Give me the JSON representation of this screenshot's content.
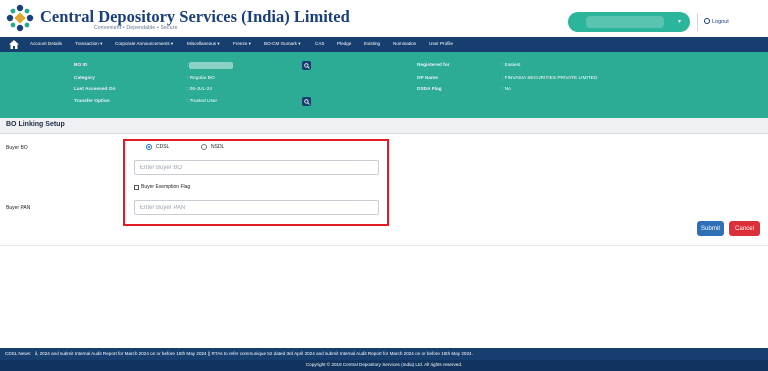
{
  "brand": {
    "title": "Central Depository Services (India) Limited",
    "tagline": "Convenient  •  Dependable  •  Secure",
    "logo_icon": "cdsl-logo-icon"
  },
  "header": {
    "logout_label": "Logout",
    "user_select_color": "#2bb59a"
  },
  "nav": {
    "items": [
      "Account Details",
      "Transaction ▾",
      "Corporate Announcements ▾",
      "Miscellaneous ▾",
      "Freeze ▾",
      "BO-CM Gumark ▾",
      "CAS",
      "Pledge",
      "Existing",
      "Nomination",
      "User Profile"
    ]
  },
  "info": {
    "bo_id_label": "BO ID",
    "bo_id_value": ":",
    "category_label": "Category",
    "category_value": ": Regular BO",
    "last_accessed_label": "Last Accessed On",
    "last_accessed_value": ": 06-JUL-24",
    "transfer_label": "Transfer Option",
    "transfer_value": ": Trusted User",
    "registered_label": "Registered for",
    "registered_value": ": Easiest",
    "dp_name_label": "DP Name",
    "dp_name_value": ": FINVASIA SECURITIES PRIVATE LIMITED",
    "ddsa_label": "DSDA Flag",
    "ddsa_value": ": No"
  },
  "form": {
    "section_title": "BO Linking Setup",
    "buyer_bo_label": "Buyer BO",
    "radio_cdsl": "CDSL",
    "radio_nsdl": "NSDL",
    "selected_depository": "CDSL",
    "buyer_bo_placeholder": "Enter Buyer BO",
    "exemption_label": "Buyer Exemption Flag",
    "buyer_pan_label": "Buyer PAN",
    "buyer_pan_placeholder": "Enter Buyer PAN",
    "submit_label": "Submit",
    "cancel_label": "Cancel"
  },
  "footer": {
    "news_label": "CDSL News:",
    "news_text": "il, 2024 and submit Internal Audit Report for March 2024 on or before 15th May 2024 || RTAs to refer communique 52 dated 3rd April 2024 and submit Internal Audit Report for March 2024 on or before 15th May 2024.",
    "copyright": "Copyright © 2018 Central Depository Services (India) Ltd. All rights reserved."
  },
  "colors": {
    "navy": "#163e6e",
    "teal": "#2cab95",
    "highlight": "#e31b23",
    "submit": "#2e6fb6",
    "cancel": "#dc2f3a"
  }
}
